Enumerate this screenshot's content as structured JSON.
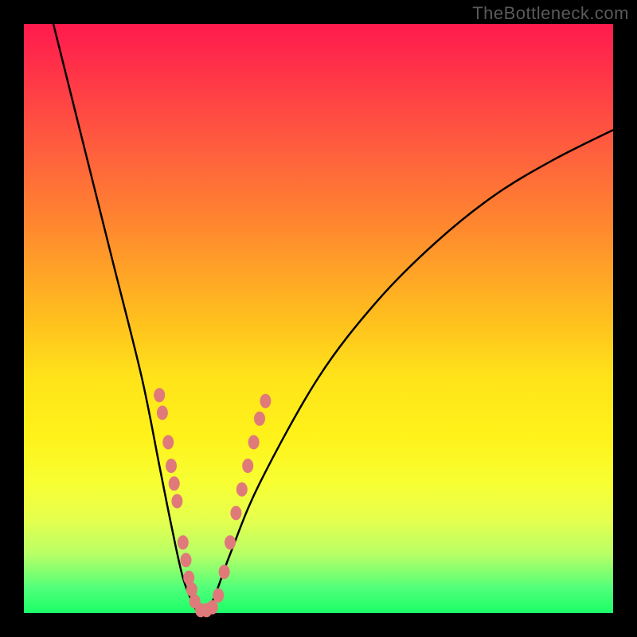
{
  "watermark": "TheBottleneck.com",
  "chart_data": {
    "type": "line",
    "title": "",
    "xlabel": "",
    "ylabel": "",
    "xlim": [
      0,
      100
    ],
    "ylim": [
      0,
      100
    ],
    "series": [
      {
        "name": "bottleneck-curve",
        "x": [
          5,
          10,
          15,
          20,
          23,
          25,
          27,
          29,
          30,
          32,
          35,
          40,
          50,
          60,
          70,
          80,
          90,
          100
        ],
        "y": [
          100,
          80,
          60,
          40,
          25,
          15,
          6,
          1,
          0,
          2,
          10,
          22,
          40,
          53,
          63,
          71,
          77,
          82
        ]
      }
    ],
    "markers": {
      "name": "highlighted-points",
      "color": "#e07a7a",
      "points": [
        {
          "x": 23.0,
          "y": 37
        },
        {
          "x": 23.5,
          "y": 34
        },
        {
          "x": 24.5,
          "y": 29
        },
        {
          "x": 25.0,
          "y": 25
        },
        {
          "x": 25.5,
          "y": 22
        },
        {
          "x": 26.0,
          "y": 19
        },
        {
          "x": 27.0,
          "y": 12
        },
        {
          "x": 27.5,
          "y": 9
        },
        {
          "x": 28.0,
          "y": 6
        },
        {
          "x": 28.5,
          "y": 4
        },
        {
          "x": 29.0,
          "y": 2
        },
        {
          "x": 30.0,
          "y": 0.5
        },
        {
          "x": 31.0,
          "y": 0.5
        },
        {
          "x": 32.0,
          "y": 1
        },
        {
          "x": 33.0,
          "y": 3
        },
        {
          "x": 34.0,
          "y": 7
        },
        {
          "x": 35.0,
          "y": 12
        },
        {
          "x": 36.0,
          "y": 17
        },
        {
          "x": 37.0,
          "y": 21
        },
        {
          "x": 38.0,
          "y": 25
        },
        {
          "x": 39.0,
          "y": 29
        },
        {
          "x": 40.0,
          "y": 33
        },
        {
          "x": 41.0,
          "y": 36
        }
      ]
    }
  }
}
